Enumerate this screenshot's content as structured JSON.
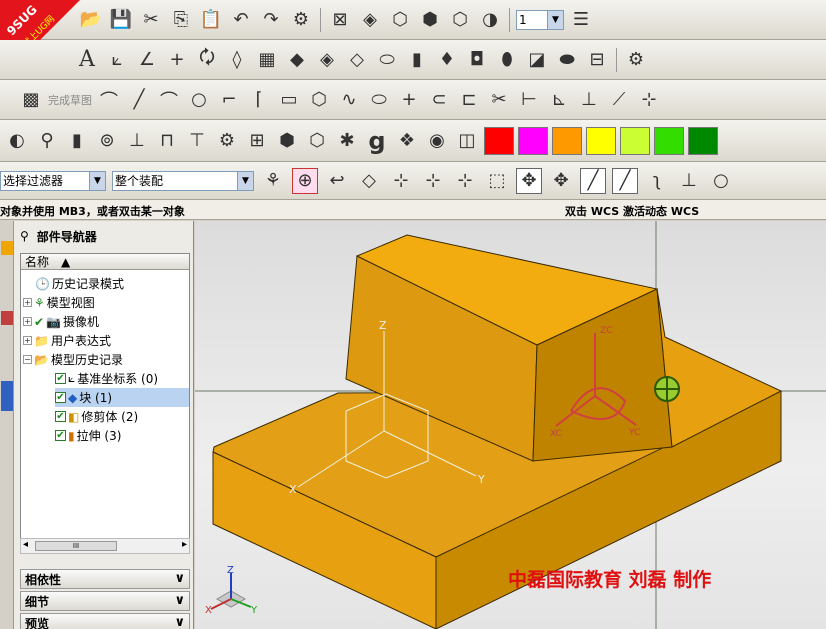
{
  "logo": {
    "text1": "9SUG",
    "text2": "学UG就上UG网"
  },
  "toolbar3": {
    "sketch_label": "完成草图"
  },
  "filters": {
    "type_filter": "选择过滤器",
    "scope": "整个装配"
  },
  "top_combo": "1",
  "status": {
    "prompt": "对象并使用 MB3，或者双击某一对象",
    "wcs": "双击 WCS 激活动态 WCS"
  },
  "navigator": {
    "title": "部件导航器",
    "column": "名称",
    "nodes": [
      {
        "label": "历史记录模式"
      },
      {
        "label": "模型视图"
      },
      {
        "label": "摄像机"
      },
      {
        "label": "用户表达式"
      },
      {
        "label": "模型历史记录"
      },
      {
        "label": "基准坐标系 (0)"
      },
      {
        "label": "块 (1)"
      },
      {
        "label": "修剪体 (2)"
      },
      {
        "label": "拉伸 (3)"
      }
    ],
    "scroll_label": "III",
    "panels": [
      {
        "label": "相依性"
      },
      {
        "label": "细节"
      },
      {
        "label": "预览"
      }
    ]
  },
  "viewport": {
    "watermark": "中磊国际教育  刘磊  制作",
    "axes": {
      "x": "X",
      "y": "Y",
      "z": "Z"
    },
    "wcs": {
      "xc": "XC",
      "yc": "YC",
      "zc": "ZC"
    }
  },
  "colors": {
    "part": "#f0a500",
    "swatches": [
      "#ff0000",
      "#ff00ff",
      "#ff9900",
      "#ffff00",
      "#ccff33",
      "#33dd00",
      "#008800"
    ]
  }
}
